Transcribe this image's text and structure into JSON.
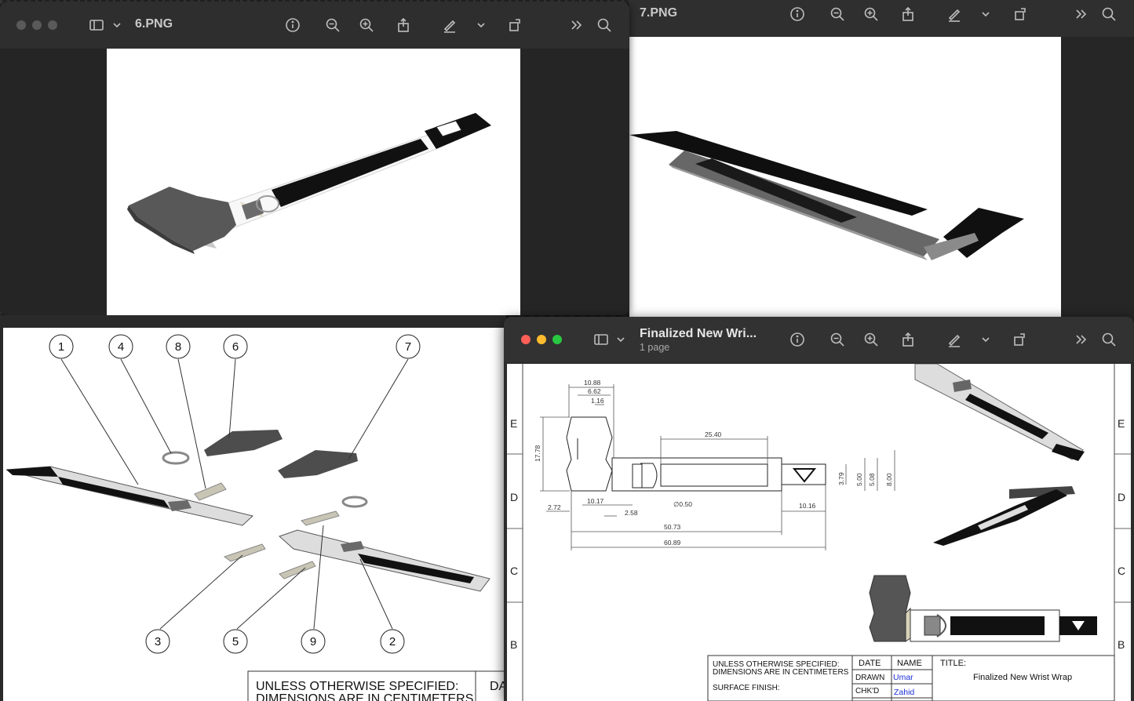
{
  "windows": {
    "w6": {
      "title": "6.PNG"
    },
    "w7": {
      "title": "7.PNG"
    },
    "w_final": {
      "title": "Finalized New Wri...",
      "subtitle": "1 page"
    }
  },
  "icons": [
    "sidebar-icon",
    "chevron-down-icon",
    "info-icon",
    "zoom-out-icon",
    "zoom-in-icon",
    "share-icon",
    "markup-pen-icon",
    "rotate-icon",
    "more-chevrons-icon",
    "search-icon"
  ],
  "exploded_view": {
    "balloons": [
      "1",
      "4",
      "8",
      "6",
      "7",
      "3",
      "5",
      "9",
      "2"
    ],
    "notes_line1": "UNLESS OTHERWISE SPECIFIED:",
    "notes_line2": "DIMENSIONS ARE IN CENTIMETERS",
    "cut_text": "DA"
  },
  "drawing": {
    "zone_letters": [
      "E",
      "D",
      "C",
      "B"
    ],
    "dimensions": {
      "d1": "10.88",
      "d2": "6.62",
      "d3": "1.16",
      "d4": "17.78",
      "d5": "25.40",
      "d6": "3.79",
      "d7": "5.00",
      "d8": "5.08",
      "d9": "8.00",
      "d10": "2.72",
      "d11": "10.17",
      "d12": "2.58",
      "d13": "∅0.50",
      "d14": "10.16",
      "d15": "50.73",
      "d16": "60.89"
    },
    "title_block": {
      "notes_line1": "UNLESS OTHERWISE SPECIFIED:",
      "notes_line2": "DIMENSIONS ARE IN CENTIMETERS",
      "surface_finish": "SURFACE FINISH:",
      "col_date": "DATE",
      "col_name": "NAME",
      "row_drawn": "DRAWN",
      "drawn_name": "Umar",
      "row_chkd": "CHK'D",
      "chkd_name": "Zahid",
      "title_label": "TITLE:",
      "title_value": "Finalized New Wrist Wrap"
    }
  },
  "colors": {
    "accent_blue": "#1d2fd6",
    "strap_black": "#111111",
    "pad_gray": "#555555"
  }
}
